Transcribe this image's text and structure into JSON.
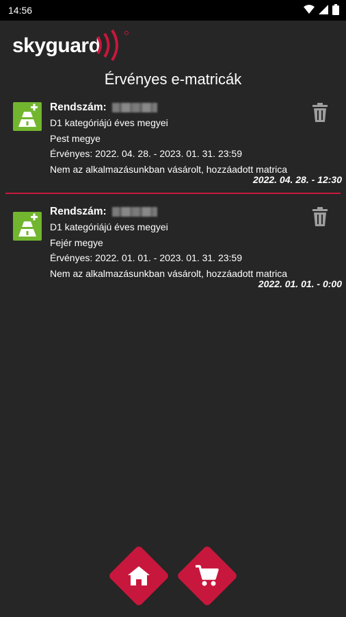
{
  "status_bar": {
    "time": "14:56"
  },
  "header": {
    "logo_text": "skyguard"
  },
  "page": {
    "title": "Érvényes e-matricák"
  },
  "vignettes": [
    {
      "plate_label": "Rendszám:",
      "category": "D1 kategóriájú éves megyei",
      "county": "Pest megye",
      "validity": "Érvényes: 2022. 04. 28. - 2023. 01. 31. 23:59",
      "note": "Nem az alkalmazásunkban vásárolt, hozzáadott matrica",
      "timestamp": "2022. 04. 28. - 12:30"
    },
    {
      "plate_label": "Rendszám:",
      "category": "D1 kategóriájú éves megyei",
      "county": "Fejér megye",
      "validity": "Érvényes: 2022. 01. 01. - 2023. 01. 31. 23:59",
      "note": "Nem az alkalmazásunkban vásárolt, hozzáadott matrica",
      "timestamp": "2022. 01. 01. - 0:00"
    }
  ],
  "icons": {
    "vignette": "highway-plus-icon",
    "delete": "trash-icon",
    "home": "home-icon",
    "cart": "cart-icon"
  },
  "colors": {
    "accent": "#c8173c",
    "vignette_green": "#72b62f",
    "background": "#262626"
  }
}
